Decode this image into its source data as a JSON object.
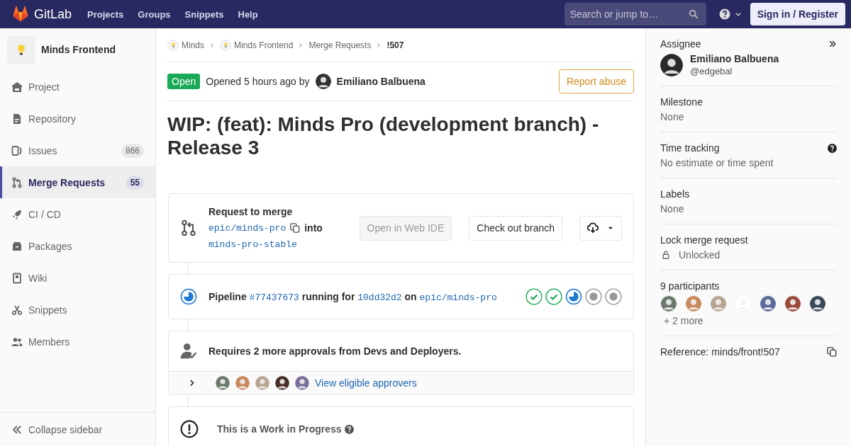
{
  "navbar": {
    "brand": "GitLab",
    "links": [
      "Projects",
      "Groups",
      "Snippets",
      "Help"
    ],
    "search": {
      "placeholder": "Search or jump to…"
    },
    "sign_in": "Sign in / Register"
  },
  "sidebar": {
    "project": "Minds Frontend",
    "items": [
      {
        "label": "Project",
        "selected": false
      },
      {
        "label": "Repository",
        "selected": false
      },
      {
        "label": "Issues",
        "count": "866",
        "selected": false
      },
      {
        "label": "Merge Requests",
        "count": "55",
        "selected": true
      },
      {
        "label": "CI / CD",
        "selected": false
      },
      {
        "label": "Packages",
        "selected": false
      },
      {
        "label": "Wiki",
        "selected": false
      },
      {
        "label": "Snippets",
        "selected": false
      },
      {
        "label": "Members",
        "selected": false
      }
    ],
    "collapse": "Collapse sidebar"
  },
  "breadcrumbs": [
    {
      "label": "Minds",
      "kind": "project"
    },
    {
      "label": "Minds Frontend",
      "kind": "project"
    },
    {
      "label": "Merge Requests",
      "kind": "link"
    },
    {
      "label": "!507",
      "kind": "current"
    }
  ],
  "mr_header": {
    "status": "Open",
    "opened": "Opened 5 hours ago by",
    "author": "Emiliano Balbuena",
    "report": "Report abuse"
  },
  "title": "WIP: (feat): Minds Pro (development branch) - Release 3",
  "merge_widget": {
    "heading": "Request to merge",
    "source": "epic/minds-pro",
    "into": "into",
    "target": "minds-pro-stable",
    "web_ide": "Open in Web IDE",
    "checkout": "Check out branch"
  },
  "pipeline": {
    "label": "Pipeline",
    "id": "#77437673",
    "status_text": "running for",
    "commit": "10dd32d2",
    "on": "on",
    "branch": "epic/minds-pro",
    "stages": [
      {
        "kind": "success"
      },
      {
        "kind": "success"
      },
      {
        "kind": "running"
      },
      {
        "kind": "created"
      },
      {
        "kind": "created"
      }
    ]
  },
  "approvals": {
    "text": "Requires 2 more approvals from Devs and Deployers.",
    "link": "View eligible approvers"
  },
  "wip": {
    "text": "This is a Work in Progress"
  },
  "right_sidebar": {
    "assignee": {
      "heading": "Assignee",
      "name": "Emiliano Balbuena",
      "username": "@edgebal"
    },
    "sections": [
      {
        "kind": "value",
        "heading": "Milestone",
        "value": "None"
      },
      {
        "kind": "help",
        "heading": "Time tracking",
        "value": "No estimate or time spent"
      },
      {
        "kind": "value",
        "heading": "Labels",
        "value": "None"
      },
      {
        "kind": "lock",
        "heading": "Lock merge request",
        "value": "Unlocked"
      }
    ],
    "participants": {
      "heading": "9 participants",
      "more": "+ 2 more"
    },
    "reference": "Reference: minds/front!507"
  }
}
